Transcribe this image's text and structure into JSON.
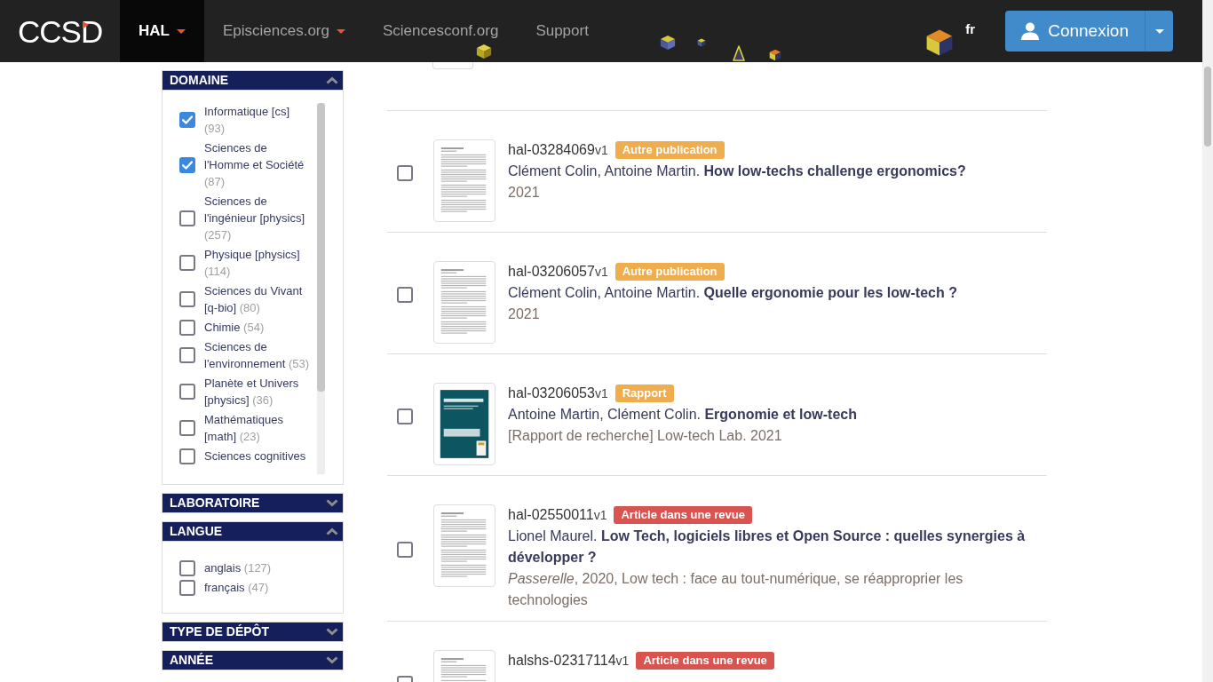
{
  "navbar": {
    "logo": "CCSD",
    "items": [
      {
        "label": "HAL",
        "selected": true,
        "dropdown": true
      },
      {
        "label": "Episciences.org",
        "selected": false,
        "dropdown": true
      },
      {
        "label": "Sciencesconf.org",
        "selected": false,
        "dropdown": false
      },
      {
        "label": "Support",
        "selected": false,
        "dropdown": false
      }
    ],
    "language": "fr",
    "login_button": "Connexion"
  },
  "facets": [
    {
      "title": "DOMAINE",
      "expanded": true,
      "options": [
        {
          "label": "Informatique [cs]",
          "count": "(93)",
          "checked": true
        },
        {
          "label": "Sciences de l'Homme et Société",
          "count": "(87)",
          "checked": true
        },
        {
          "label": "Sciences de l'ingénieur [physics]",
          "count": "(257)",
          "checked": false
        },
        {
          "label": "Physique [physics]",
          "count": "(114)",
          "checked": false
        },
        {
          "label": "Sciences du Vivant [q-bio]",
          "count": "(80)",
          "checked": false
        },
        {
          "label": "Chimie",
          "count": "(54)",
          "checked": false
        },
        {
          "label": "Sciences de l'environnement",
          "count": "(53)",
          "checked": false
        },
        {
          "label": "Planète et Univers [physics]",
          "count": "(36)",
          "checked": false
        },
        {
          "label": "Mathématiques [math]",
          "count": "(23)",
          "checked": false
        },
        {
          "label": "Sciences cognitives",
          "checked": false
        }
      ]
    },
    {
      "title": "LABORATOIRE",
      "expanded": false
    },
    {
      "title": "LANGUE",
      "expanded": true,
      "options": [
        {
          "label": "anglais",
          "count": "(127)",
          "checked": false
        },
        {
          "label": "français",
          "count": "(47)",
          "checked": false
        }
      ]
    },
    {
      "title": "TYPE DE DÉPÔT",
      "expanded": false
    },
    {
      "title": "ANNÉE",
      "expanded": false
    }
  ],
  "results": [
    {
      "checked": false,
      "id": "hal-03284069",
      "version": "v1",
      "doc_type": {
        "label": "Autre publication",
        "color": "#f0ad4e"
      },
      "citation": "Clément Colin, Antoine Martin. **How low-techs challenge ergonomics?**",
      "details": "2021",
      "thumbnail": {
        "kind": "page"
      }
    },
    {
      "checked": false,
      "id": "hal-03206057",
      "version": "v1",
      "doc_type": {
        "label": "Autre publication",
        "color": "#f0ad4e"
      },
      "citation": "Clément Colin, Antoine Martin. **Quelle ergonomie pour les low-tech ?**",
      "details": "2021",
      "thumbnail": {
        "kind": "page"
      }
    },
    {
      "checked": false,
      "id": "hal-03206053",
      "version": "v1",
      "doc_type": {
        "label": "Rapport",
        "color": "#f0ad4e"
      },
      "citation": "Antoine Martin, Clément Colin. **Ergonomie et low-tech**",
      "details": "[Rapport de recherche] Low-tech Lab. 2021",
      "thumbnail": {
        "kind": "cover"
      }
    },
    {
      "checked": false,
      "id": "hal-02550011",
      "version": "v1",
      "doc_type": {
        "label": "Article dans une revue",
        "color": "#d9534f"
      },
      "citation": "Lionel Maurel. **Low Tech, logiciels libres et Open Source : quelles synergies à développer ?**",
      "details": "*Passerelle*, 2020, Low tech : face au tout-numérique, se réapproprier les technologies",
      "thumbnail": {
        "kind": "page"
      }
    },
    {
      "checked": false,
      "id": "halshs-02317114",
      "version": "v1",
      "doc_type": {
        "label": "Article dans une revue",
        "color": "#d9534f"
      },
      "thumbnail": {
        "kind": "page"
      }
    }
  ]
}
